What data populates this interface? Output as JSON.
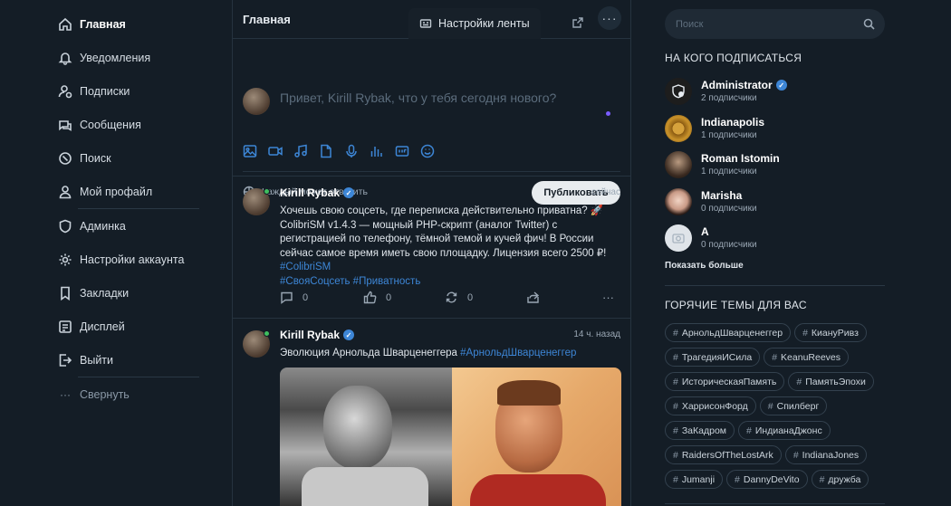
{
  "nav": {
    "items": [
      {
        "label": "Главная",
        "icon": "home-icon"
      },
      {
        "label": "Уведомления",
        "icon": "bell-icon"
      },
      {
        "label": "Подписки",
        "icon": "user-follow-icon"
      },
      {
        "label": "Сообщения",
        "icon": "chat-icon"
      },
      {
        "label": "Поиск",
        "icon": "search-icon"
      },
      {
        "label": "Мой профайл",
        "icon": "user-icon"
      },
      {
        "label": "Админка",
        "icon": "shield-icon"
      },
      {
        "label": "Настройки аккаунта",
        "icon": "gear-icon"
      },
      {
        "label": "Закладки",
        "icon": "bookmark-icon"
      },
      {
        "label": "Дисплей",
        "icon": "display-icon"
      },
      {
        "label": "Выйти",
        "icon": "logout-icon"
      }
    ],
    "collapse_label": "Свернуть"
  },
  "header": {
    "title": "Главная",
    "feed_settings": "Настройки ленты",
    "more": "···"
  },
  "composer": {
    "placeholder": "Привет, Kirill Rybak, что у тебя сегодня нового?",
    "reply_setting": "Каждый может ответить",
    "publish_label": "Публиковать",
    "tools": [
      "image-icon",
      "video-icon",
      "music-icon",
      "file-icon",
      "mic-icon",
      "poll-icon",
      "gif-icon",
      "emoji-icon"
    ]
  },
  "posts": [
    {
      "author": "Kirill Rybak",
      "time": "сейчас",
      "text": "Хочешь свою соцсеть, где переписка действительно приватна? 🚀 ColibriSM v1.4.3 — мощный PHP-скрипт (аналог Twitter) с регистрацией по телефону, тёмной темой и кучей фич! В России сейчас самое время иметь свою площадку. Лицензия всего 2500 ₽! ",
      "tags": "#ColibriSM",
      "tags2": "#СвояСоцсеть #Приватность",
      "comments": "0",
      "likes": "0",
      "reposts": "0"
    },
    {
      "author": "Kirill Rybak",
      "time": "14 ч. назад",
      "text": "Эволюция Арнольда Шварценеггера ",
      "tags": "#АрнольдШварценеггер"
    }
  ],
  "search": {
    "placeholder": "Поиск"
  },
  "who_to_follow": {
    "title": "НА КОГО ПОДПИСАТЬСЯ",
    "users": [
      {
        "name": "Administrator",
        "sub": "2 подписчики",
        "verified": true
      },
      {
        "name": "Indianapolis",
        "sub": "1 подписчики",
        "verified": false
      },
      {
        "name": "Roman Istomin",
        "sub": "1 подписчики",
        "verified": false
      },
      {
        "name": "Marisha",
        "sub": "0 подписчики",
        "verified": false
      },
      {
        "name": "A",
        "sub": "0 подписчики",
        "verified": false
      }
    ],
    "show_more": "Показать больше"
  },
  "trends": {
    "title": "ГОРЯЧИЕ ТЕМЫ ДЛЯ ВАС",
    "tags": [
      "АрнольдШварценеггер",
      "КиануРивз",
      "ТрагедияИСила",
      "KeanuReeves",
      "ИсторическаяПамять",
      "ПамятьЭпохи",
      "ХаррисонФорд",
      "Спилберг",
      "ЗаКадром",
      "ИндианаДжонс",
      "RaidersOfTheLostArk",
      "IndianaJones",
      "Jumanji",
      "DannyDeVito",
      "дружба"
    ]
  },
  "colors": {
    "background": "#141d26",
    "accent": "#3d86d6",
    "online": "#3fbf5f"
  }
}
